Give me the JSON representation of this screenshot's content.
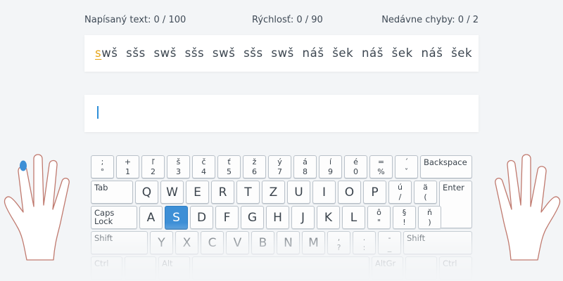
{
  "stats": {
    "typed": "Napísaný text: 0 / 100",
    "speed": "Rýchlosť: 0 / 90",
    "errors": "Nedávne chyby: 0 / 2"
  },
  "lesson": {
    "current_char": "s",
    "remaining_text": "wš  sšs  swš  sšs  swš  sšs  swš  náš  šek  náš  šek  náš  šek"
  },
  "input": {
    "value": ""
  },
  "colors": {
    "accent": "#3d8fd6",
    "current_char": "#e6a417",
    "caret": "#2f8fd8"
  },
  "icons": {
    "left_hand": "left-hand-icon",
    "right_hand": "right-hand-icon"
  },
  "keyboard": {
    "row1": [
      {
        "top": ";",
        "bottom": "°"
      },
      {
        "top": "+",
        "bottom": "1"
      },
      {
        "top": "ľ",
        "bottom": "2"
      },
      {
        "top": "š",
        "bottom": "3"
      },
      {
        "top": "č",
        "bottom": "4"
      },
      {
        "top": "ť",
        "bottom": "5"
      },
      {
        "top": "ž",
        "bottom": "6"
      },
      {
        "top": "ý",
        "bottom": "7"
      },
      {
        "top": "á",
        "bottom": "8"
      },
      {
        "top": "í",
        "bottom": "9"
      },
      {
        "top": "é",
        "bottom": "0"
      },
      {
        "top": "=",
        "bottom": "%"
      },
      {
        "top": "´",
        "bottom": "ˇ"
      }
    ],
    "backspace": "Backspace",
    "tab": "Tab",
    "row2": [
      "Q",
      "W",
      "E",
      "R",
      "T",
      "Z",
      "U",
      "I",
      "O",
      "P"
    ],
    "row2_extra": [
      {
        "top": "ú",
        "bottom": "/"
      },
      {
        "top": "ä",
        "bottom": "("
      }
    ],
    "enter": "Enter",
    "caps": "Caps\nLock",
    "row3": [
      "A",
      "S",
      "D",
      "F",
      "G",
      "H",
      "J",
      "K",
      "L"
    ],
    "row3_extra": [
      {
        "top": "ô",
        "bottom": "\""
      },
      {
        "top": "§",
        "bottom": "!"
      },
      {
        "top": "ň",
        "bottom": ")"
      }
    ],
    "shift_left": "Shift",
    "row4": [
      "Y",
      "X",
      "C",
      "V",
      "B",
      "N",
      "M"
    ],
    "row4_extra": [
      {
        "top": ",",
        "bottom": "?"
      },
      {
        "top": ".",
        "bottom": ":"
      },
      {
        "top": "-",
        "bottom": "_"
      }
    ],
    "shift_right": "Shift",
    "ctrl_left": "Ctrl",
    "alt": "Alt",
    "altgr": "AltGr",
    "ctrl_right": "Ctrl",
    "active_key": "S"
  }
}
